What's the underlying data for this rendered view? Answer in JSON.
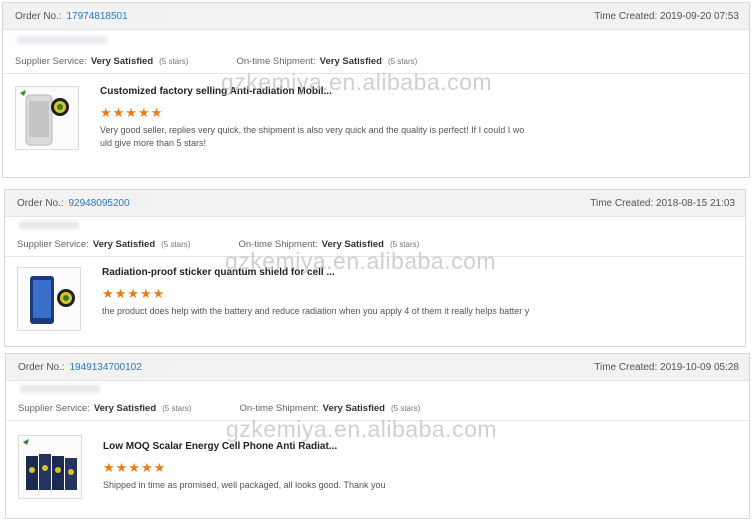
{
  "watermark": "gzkemiya.en.alibaba.com",
  "labels": {
    "order_no": "Order No.:",
    "time_created": "Time Created:",
    "supplier_service": "Supplier Service:",
    "on_time_shipment": "On-time Shipment:"
  },
  "orders": [
    {
      "order_no": "17974818501",
      "time": "2019-09-20 07:53",
      "supplier_rating": "Very Satisfied",
      "supplier_stars": "(5 stars)",
      "shipment_rating": "Very Satisfied",
      "shipment_stars": "(5 stars)",
      "product_title": "Customized factory selling Anti-radiation Mobil...",
      "stars": "★★★★★",
      "review": "Very good seller, replies very quick, the shipment is also very quick and the quality is perfect! If I could I wo uld give more than 5 stars!"
    },
    {
      "order_no": "92948095200",
      "time": "2018-08-15 21:03",
      "supplier_rating": "Very Satisfied",
      "supplier_stars": "(5 stars)",
      "shipment_rating": "Very Satisfied",
      "shipment_stars": "(5 stars)",
      "product_title": "Radiation-proof sticker quantum shield for cell ...",
      "stars": "★★★★★",
      "review": "the product does help with the battery and reduce radiation when you apply 4 of them it really helps batter y"
    },
    {
      "order_no": "1949134700102",
      "time": "2019-10-09 05:28",
      "supplier_rating": "Very Satisfied",
      "supplier_stars": "(5 stars)",
      "shipment_rating": "Very Satisfied",
      "shipment_stars": "(5 stars)",
      "product_title": "Low MOQ Scalar Energy Cell Phone Anti Radiat...",
      "stars": "★★★★★",
      "review": "Shipped in time as promised, well packaged, all looks good. Thank you"
    }
  ]
}
